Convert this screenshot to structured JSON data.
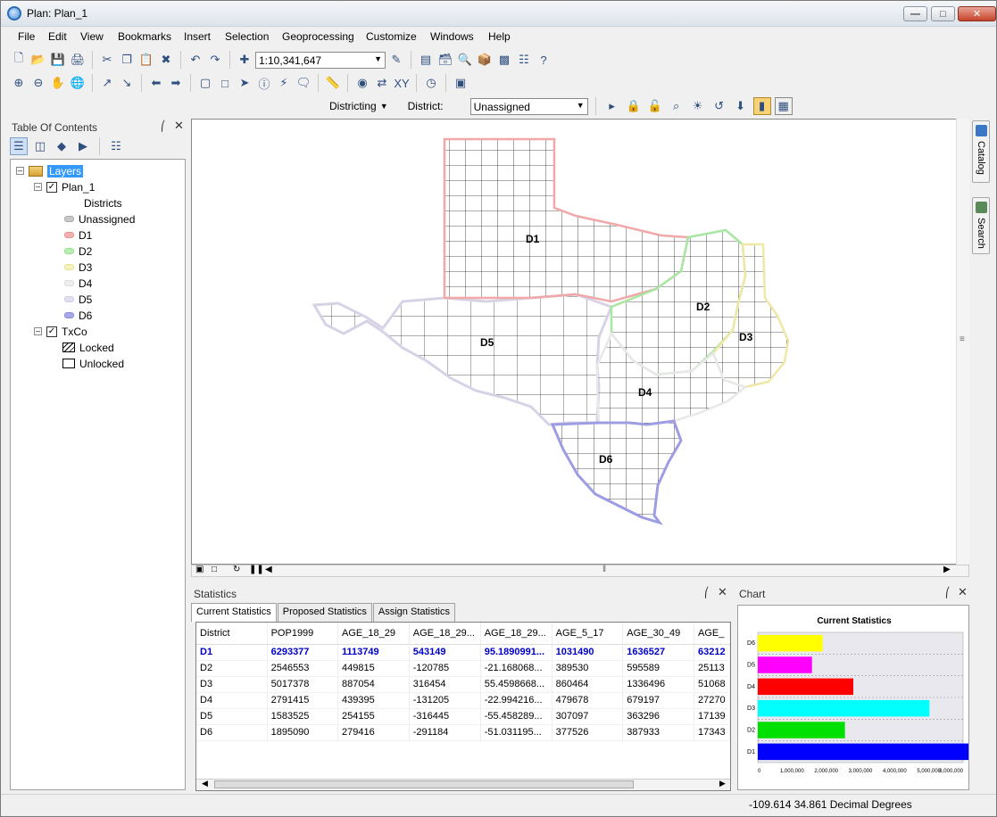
{
  "window": {
    "title": "Plan:  Plan_1"
  },
  "menu": [
    "File",
    "Edit",
    "View",
    "Bookmarks",
    "Insert",
    "Selection",
    "Geoprocessing",
    "Customize",
    "Windows",
    "Help"
  ],
  "toolbar": {
    "scale": "1:10,341,647"
  },
  "districting": {
    "menu_label": "Districting",
    "district_label": "District:",
    "district_value": "Unassigned"
  },
  "toc": {
    "title": "Table Of Contents",
    "layers_label": "Layers",
    "plan_layer": "Plan_1",
    "districts_label": "Districts",
    "legend": [
      {
        "label": "Unassigned",
        "color": "#c8c8c8"
      },
      {
        "label": "D1",
        "color": "#f3b0b0"
      },
      {
        "label": "D2",
        "color": "#b6f0b0"
      },
      {
        "label": "D3",
        "color": "#f7f3b8"
      },
      {
        "label": "D4",
        "color": "#eeeeee"
      },
      {
        "label": "D5",
        "color": "#e4dff0"
      },
      {
        "label": "D6",
        "color": "#a7a8ea"
      }
    ],
    "txco_layer": "TxCo",
    "locked_label": "Locked",
    "unlocked_label": "Unlocked"
  },
  "map": {
    "labels": [
      {
        "text": "D1"
      },
      {
        "text": "D2"
      },
      {
        "text": "D3"
      },
      {
        "text": "D4"
      },
      {
        "text": "D5"
      },
      {
        "text": "D6"
      }
    ]
  },
  "dock": {
    "catalog": "Catalog",
    "search": "Search"
  },
  "statistics": {
    "title": "Statistics",
    "tabs": [
      "Current Statistics",
      "Proposed Statistics",
      "Assign Statistics"
    ],
    "columns": [
      "District",
      "POP1999",
      "AGE_18_29",
      "AGE_18_29...",
      "AGE_18_29...",
      "AGE_5_17",
      "AGE_30_49",
      "AGE_"
    ],
    "rows": [
      [
        "D1",
        "6293377",
        "1113749",
        "543149",
        "95.1890991...",
        "1031490",
        "1636527",
        "63212"
      ],
      [
        "D2",
        "2546553",
        "449815",
        "-120785",
        "-21.168068...",
        "389530",
        "595589",
        "25113"
      ],
      [
        "D3",
        "5017378",
        "887054",
        "316454",
        "55.4598668...",
        "860464",
        "1336496",
        "51068"
      ],
      [
        "D4",
        "2791415",
        "439395",
        "-131205",
        "-22.994216...",
        "479678",
        "679197",
        "27270"
      ],
      [
        "D5",
        "1583525",
        "254155",
        "-316445",
        "-55.458289...",
        "307097",
        "363296",
        "17139"
      ],
      [
        "D6",
        "1895090",
        "279416",
        "-291184",
        "-51.031195...",
        "377526",
        "387933",
        "17343"
      ]
    ]
  },
  "chart_panel": {
    "title": "Chart"
  },
  "chart_data": {
    "type": "bar",
    "orientation": "horizontal",
    "title": "Current Statistics",
    "categories": [
      "D1",
      "D2",
      "D3",
      "D4",
      "D5",
      "D6"
    ],
    "values": [
      6293377,
      2546553,
      5017378,
      2791415,
      1583525,
      1895090
    ],
    "colors": [
      "#0000ff",
      "#00e000",
      "#00ffff",
      "#ff0000",
      "#ff00ff",
      "#ffff00"
    ],
    "xlim": [
      0,
      6000000
    ],
    "xticks": [
      "0",
      "1,000,000",
      "2,000,000",
      "3,000,000",
      "4,000,000",
      "5,000,000",
      "6,000,000"
    ],
    "grid": true
  },
  "status": {
    "coords": "-109.614  34.861 Decimal Degrees"
  }
}
